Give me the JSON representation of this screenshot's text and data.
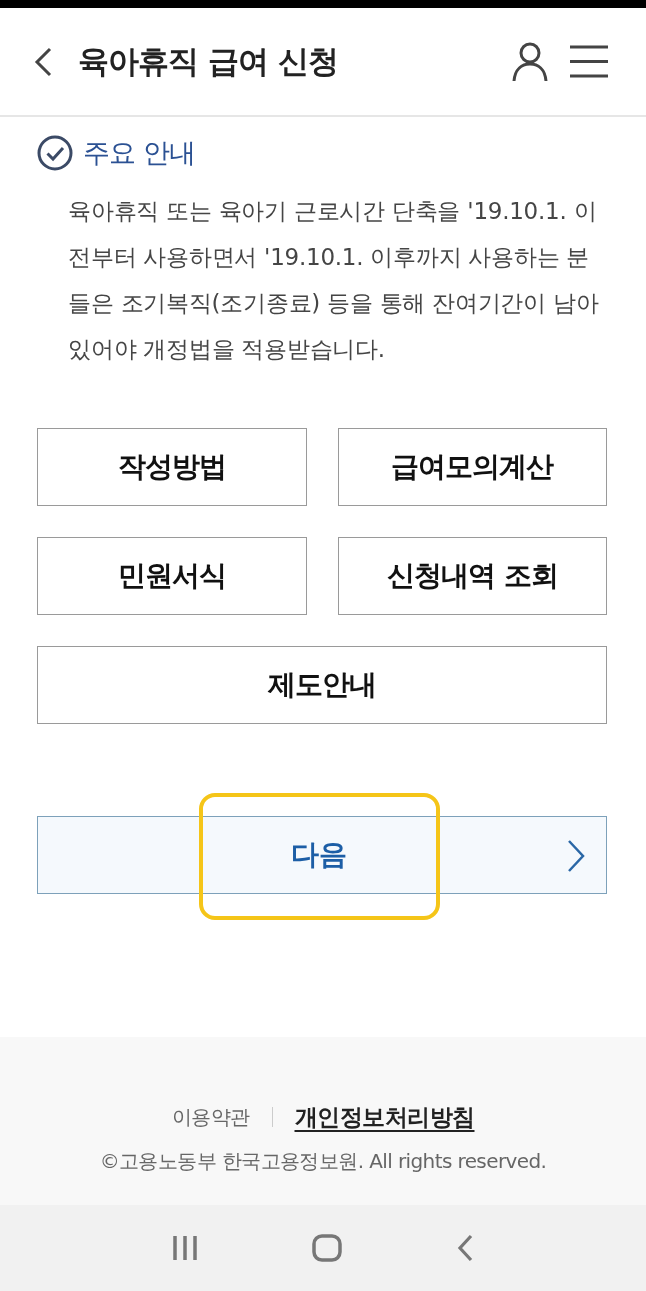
{
  "header": {
    "title": "육아휴직 급여 신청"
  },
  "notice": {
    "title": "주요 안내",
    "text": "육아휴직 또는 육아기 근로시간 단축을 '19.10.1. 이전부터 사용하면서 '19.10.1. 이후까지 사용하는 분들은 조기복직(조기종료) 등을 통해 잔여기간이 남아있어야 개정법을 적용받습니다."
  },
  "shortcuts": [
    {
      "label": "작성방법"
    },
    {
      "label": "급여모의계산"
    },
    {
      "label": "민원서식"
    },
    {
      "label": "신청내역 조회"
    },
    {
      "label": "제도안내"
    }
  ],
  "next_button": {
    "label": "다음",
    "highlighted": true
  },
  "footer": {
    "links": [
      {
        "label": "이용약관",
        "emphasized": false
      },
      {
        "label": "개인정보처리방침",
        "emphasized": true
      }
    ],
    "copyright": "©고용노동부 한국고용정보원. All rights reserved."
  }
}
